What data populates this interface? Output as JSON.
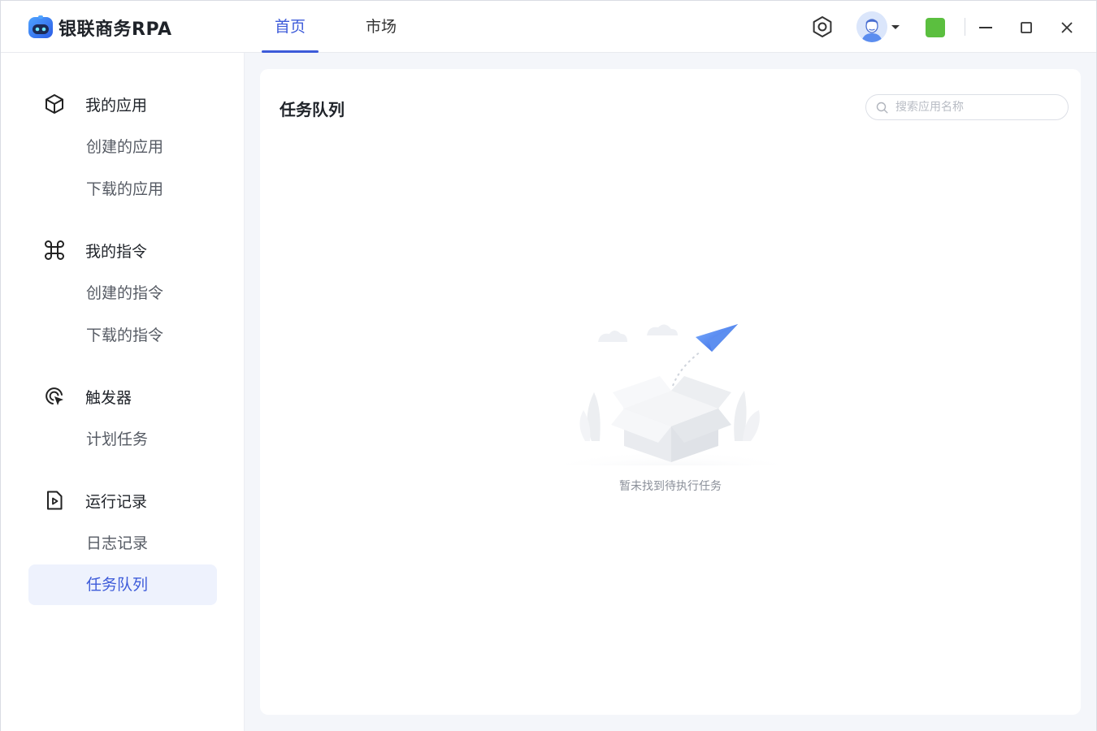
{
  "app": {
    "name": "银联商务RPA"
  },
  "nav": {
    "tabs": [
      {
        "label": "首页",
        "active": true
      },
      {
        "label": "市场",
        "active": false
      }
    ]
  },
  "titlebar": {
    "icons": [
      "settings-icon",
      "user-avatar",
      "chevron-down-icon",
      "status-indicator",
      "minimize-icon",
      "maximize-icon",
      "close-icon"
    ],
    "status_color": "#5bbf3f"
  },
  "sidebar": {
    "groups": [
      {
        "label": "我的应用",
        "icon": "cube-icon",
        "items": [
          {
            "label": "创建的应用"
          },
          {
            "label": "下载的应用"
          }
        ]
      },
      {
        "label": "我的指令",
        "icon": "command-icon",
        "items": [
          {
            "label": "创建的指令"
          },
          {
            "label": "下载的指令"
          }
        ]
      },
      {
        "label": "触发器",
        "icon": "target-cursor-icon",
        "items": [
          {
            "label": "计划任务"
          }
        ]
      },
      {
        "label": "运行记录",
        "icon": "play-document-icon",
        "items": [
          {
            "label": "日志记录"
          },
          {
            "label": "任务队列",
            "active": true
          }
        ]
      }
    ]
  },
  "main": {
    "title": "任务队列",
    "search": {
      "placeholder": "搜索应用名称",
      "value": ""
    },
    "empty_state": {
      "message": "暂未找到待执行任务",
      "icon": "empty-box-paper-plane-illustration"
    }
  },
  "colors": {
    "accent": "#3d5bd9",
    "active_bg": "#eef2fd",
    "content_bg": "#f4f6fa"
  }
}
